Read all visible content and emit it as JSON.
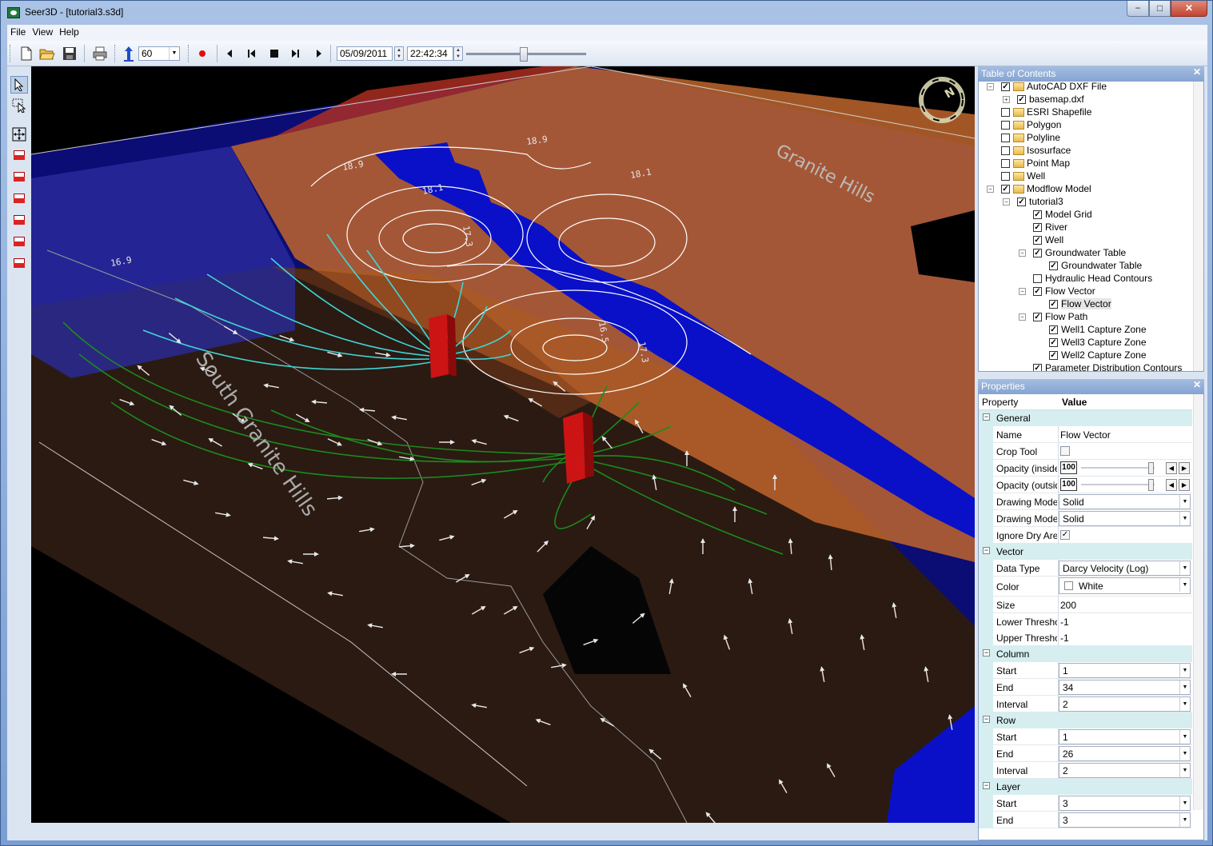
{
  "window": {
    "title": "Seer3D - [tutorial3.s3d]",
    "minimize": "−",
    "maximize": "□",
    "close": "✕"
  },
  "menu": {
    "file": "File",
    "view": "View",
    "help": "Help"
  },
  "toolbar": {
    "speed": "60",
    "date": "05/09/2011",
    "time": "22:42:34",
    "time_slider_position": 0.5
  },
  "viewport": {
    "labels": {
      "granite_hills": "Granite Hills",
      "south_granite_hills": "South Granite Hills"
    },
    "contour_labels": [
      "18.9",
      "18.1",
      "18.9",
      "18.1",
      "17.3",
      "16.5",
      "17.3",
      "16.9"
    ],
    "compass": "N"
  },
  "toc": {
    "title": "Table of Contents",
    "items": [
      {
        "label": "AutoCAD DXF File",
        "checked": true,
        "folder": true
      },
      {
        "label": "basemap.dxf",
        "checked": true
      },
      {
        "label": "ESRI Shapefile",
        "checked": false,
        "folder": true
      },
      {
        "label": "Polygon",
        "checked": false,
        "folder": true
      },
      {
        "label": "Polyline",
        "checked": false,
        "folder": true
      },
      {
        "label": "Isosurface",
        "checked": false,
        "folder": true
      },
      {
        "label": "Point Map",
        "checked": false,
        "folder": true
      },
      {
        "label": "Well",
        "checked": false,
        "folder": true
      },
      {
        "label": "Modflow Model",
        "checked": true,
        "folder": true
      },
      {
        "label": "tutorial3",
        "checked": true
      },
      {
        "label": "Model Grid",
        "checked": true
      },
      {
        "label": "River",
        "checked": true
      },
      {
        "label": "Well",
        "checked": true
      },
      {
        "label": "Groundwater Table",
        "checked": true
      },
      {
        "label": "Groundwater Table",
        "checked": true
      },
      {
        "label": "Hydraulic Head Contours",
        "checked": false
      },
      {
        "label": "Flow Vector",
        "checked": true
      },
      {
        "label": "Flow Vector",
        "checked": true
      },
      {
        "label": "Flow Path",
        "checked": true
      },
      {
        "label": "Well1 Capture Zone",
        "checked": true
      },
      {
        "label": "Well3 Capture Zone",
        "checked": true
      },
      {
        "label": "Well2 Capture Zone",
        "checked": true
      },
      {
        "label": "Parameter Distribution Contours",
        "checked": true
      }
    ]
  },
  "properties": {
    "title": "Properties",
    "col_property": "Property",
    "col_value": "Value",
    "general": "General",
    "name_label": "Name",
    "name_value": "Flow Vector",
    "crop_label": "Crop Tool",
    "op_in_label": "Opacity (inside c",
    "op_in_value": "100",
    "op_out_label": "Opacity (outside",
    "op_out_value": "100",
    "dm1_label": "Drawing Mode (",
    "dm1_value": "Solid",
    "dm2_label": "Drawing Mode (",
    "dm2_value": "Solid",
    "ignore_label": "Ignore Dry Areas",
    "vector": "Vector",
    "dtype_label": "Data Type",
    "dtype_value": "Darcy Velocity (Log)",
    "color_label": "Color",
    "color_value": "White",
    "size_label": "Size",
    "size_value": "200",
    "lower_label": "Lower Threshold",
    "lower_value": "-1",
    "upper_label": "Upper Threshold",
    "upper_value": "-1",
    "column": "Column",
    "col_start_label": "Start",
    "col_start": "1",
    "col_end_label": "End",
    "col_end": "34",
    "col_int_label": "Interval",
    "col_int": "2",
    "row": "Row",
    "row_start_label": "Start",
    "row_start": "1",
    "row_end_label": "End",
    "row_end": "26",
    "row_int_label": "Interval",
    "row_int": "2",
    "layer": "Layer",
    "lay_start_label": "Start",
    "lay_start": "3",
    "lay_end_label": "End",
    "lay_end": "3"
  },
  "colors": {
    "water": "#0a10c8",
    "plane": "#c0652c",
    "wells": "#cc1414",
    "flowpath_cyan": "#3fd6d6",
    "flowpath_green": "#1d8a1d"
  }
}
